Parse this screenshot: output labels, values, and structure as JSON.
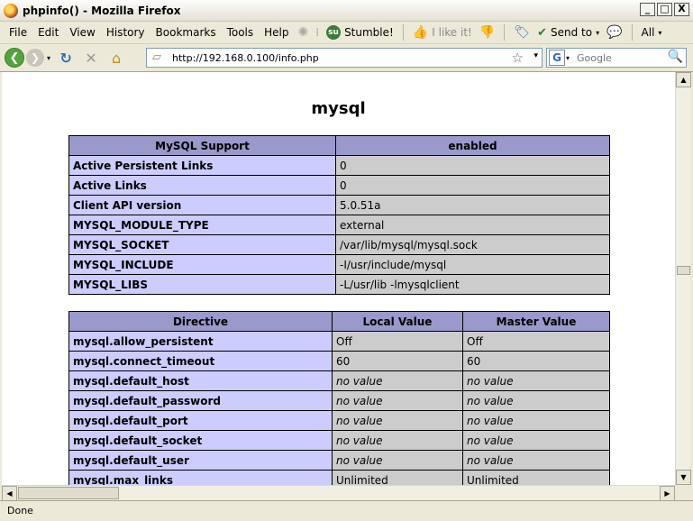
{
  "window": {
    "title": "phpinfo() - Mozilla Firefox",
    "minimize": "_",
    "maximize": "□",
    "close": "X"
  },
  "menu": {
    "items": [
      "File",
      "Edit",
      "View",
      "History",
      "Bookmarks",
      "Tools",
      "Help"
    ],
    "stumble": "Stumble!",
    "ilike": "I like it!",
    "sendto": "Send to",
    "all": "All"
  },
  "nav": {
    "url": "http://192.168.0.100/info.php",
    "search_placeholder": "Google",
    "search_engine_letter": "G"
  },
  "content": {
    "section_title": "mysql",
    "support_table": {
      "headers": [
        "MySQL Support",
        "enabled"
      ],
      "rows": [
        [
          "Active Persistent Links",
          "0"
        ],
        [
          "Active Links",
          "0"
        ],
        [
          "Client API version",
          "5.0.51a"
        ],
        [
          "MYSQL_MODULE_TYPE",
          "external"
        ],
        [
          "MYSQL_SOCKET",
          "/var/lib/mysql/mysql.sock"
        ],
        [
          "MYSQL_INCLUDE",
          "-I/usr/include/mysql"
        ],
        [
          "MYSQL_LIBS",
          "-L/usr/lib -lmysqlclient"
        ]
      ]
    },
    "directive_table": {
      "headers": [
        "Directive",
        "Local Value",
        "Master Value"
      ],
      "rows": [
        [
          "mysql.allow_persistent",
          "Off",
          "Off"
        ],
        [
          "mysql.connect_timeout",
          "60",
          "60"
        ],
        [
          "mysql.default_host",
          "no value",
          "no value"
        ],
        [
          "mysql.default_password",
          "no value",
          "no value"
        ],
        [
          "mysql.default_port",
          "no value",
          "no value"
        ],
        [
          "mysql.default_socket",
          "no value",
          "no value"
        ],
        [
          "mysql.default_user",
          "no value",
          "no value"
        ],
        [
          "mysql.max_links",
          "Unlimited",
          "Unlimited"
        ]
      ]
    }
  },
  "status": {
    "text": "Done"
  }
}
